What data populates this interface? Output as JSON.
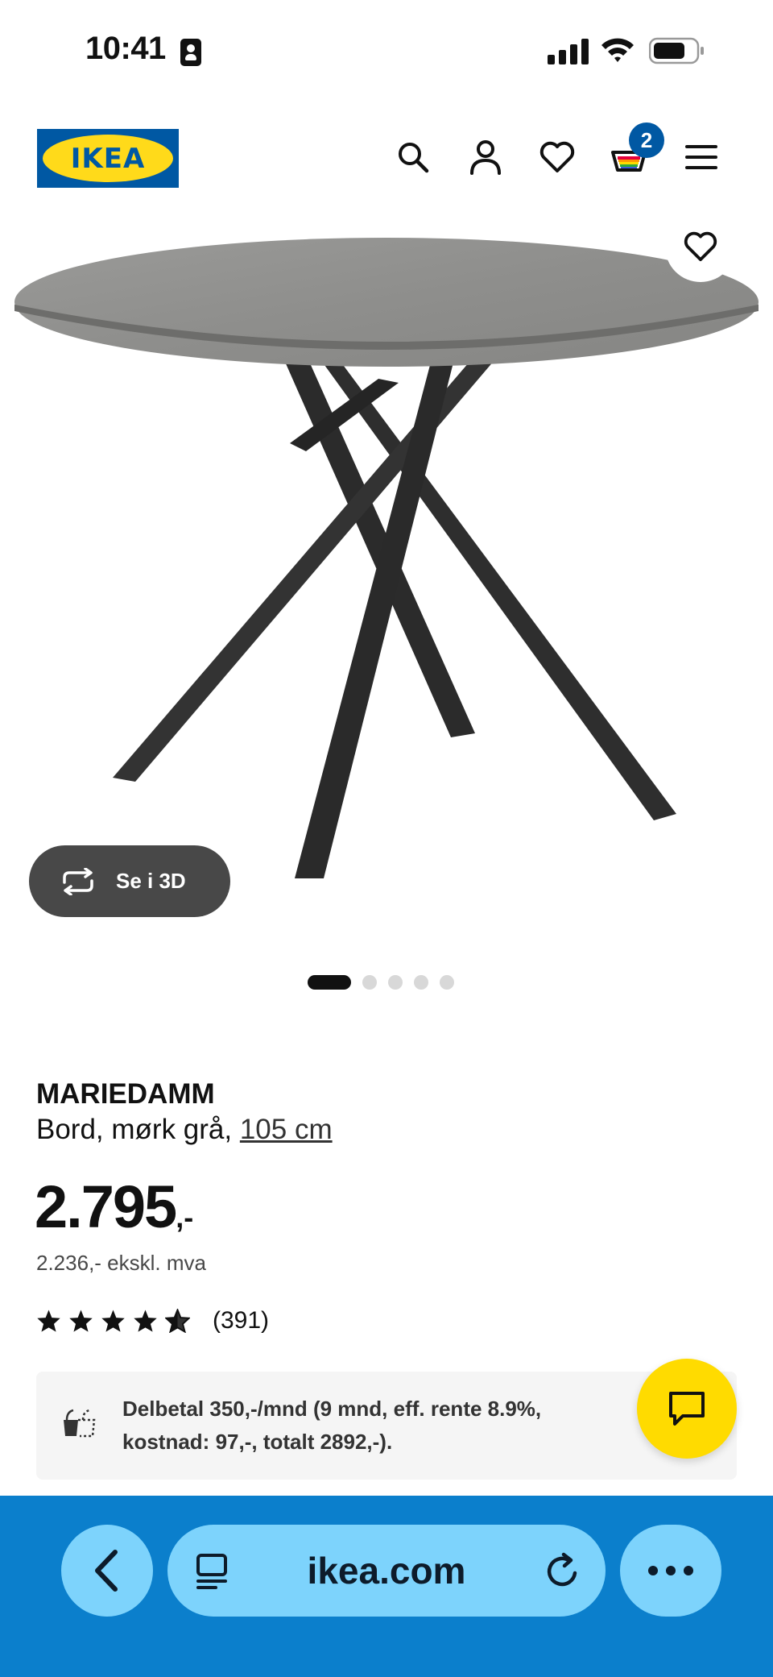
{
  "status_bar": {
    "time": "10:41"
  },
  "header": {
    "logo_text": "IKEA",
    "cart_count": "2",
    "icons": [
      "search-icon",
      "user-icon",
      "heart-icon",
      "cart-icon",
      "menu-icon"
    ]
  },
  "gallery": {
    "view_3d_label": "Se i 3D",
    "slide_count": 5,
    "active_slide": 1
  },
  "product": {
    "name": "MARIEDAMM",
    "description": "Bord, mørk grå,",
    "size_link": "105 cm",
    "price": "2.795",
    "price_suffix": ",-",
    "price_ex_vat": "2.236,- ekskl. mva",
    "rating_stars": 4.5,
    "rating_count": "(391)"
  },
  "installment": {
    "text_line1": "Delbetal 350,-/mnd (9 mnd, eff. rente 8.9%,",
    "text_line2": "kostnad: 97,-, totalt 2892,-)."
  },
  "browser": {
    "url": "ikea.com"
  },
  "colors": {
    "ikea_blue": "#0058a3",
    "ikea_yellow": "#ffda1a",
    "browser_bar": "#0b7fcc",
    "browser_pill": "#7dd3fc",
    "chat_button": "#ffdb00",
    "btn_3d": "#484848"
  }
}
